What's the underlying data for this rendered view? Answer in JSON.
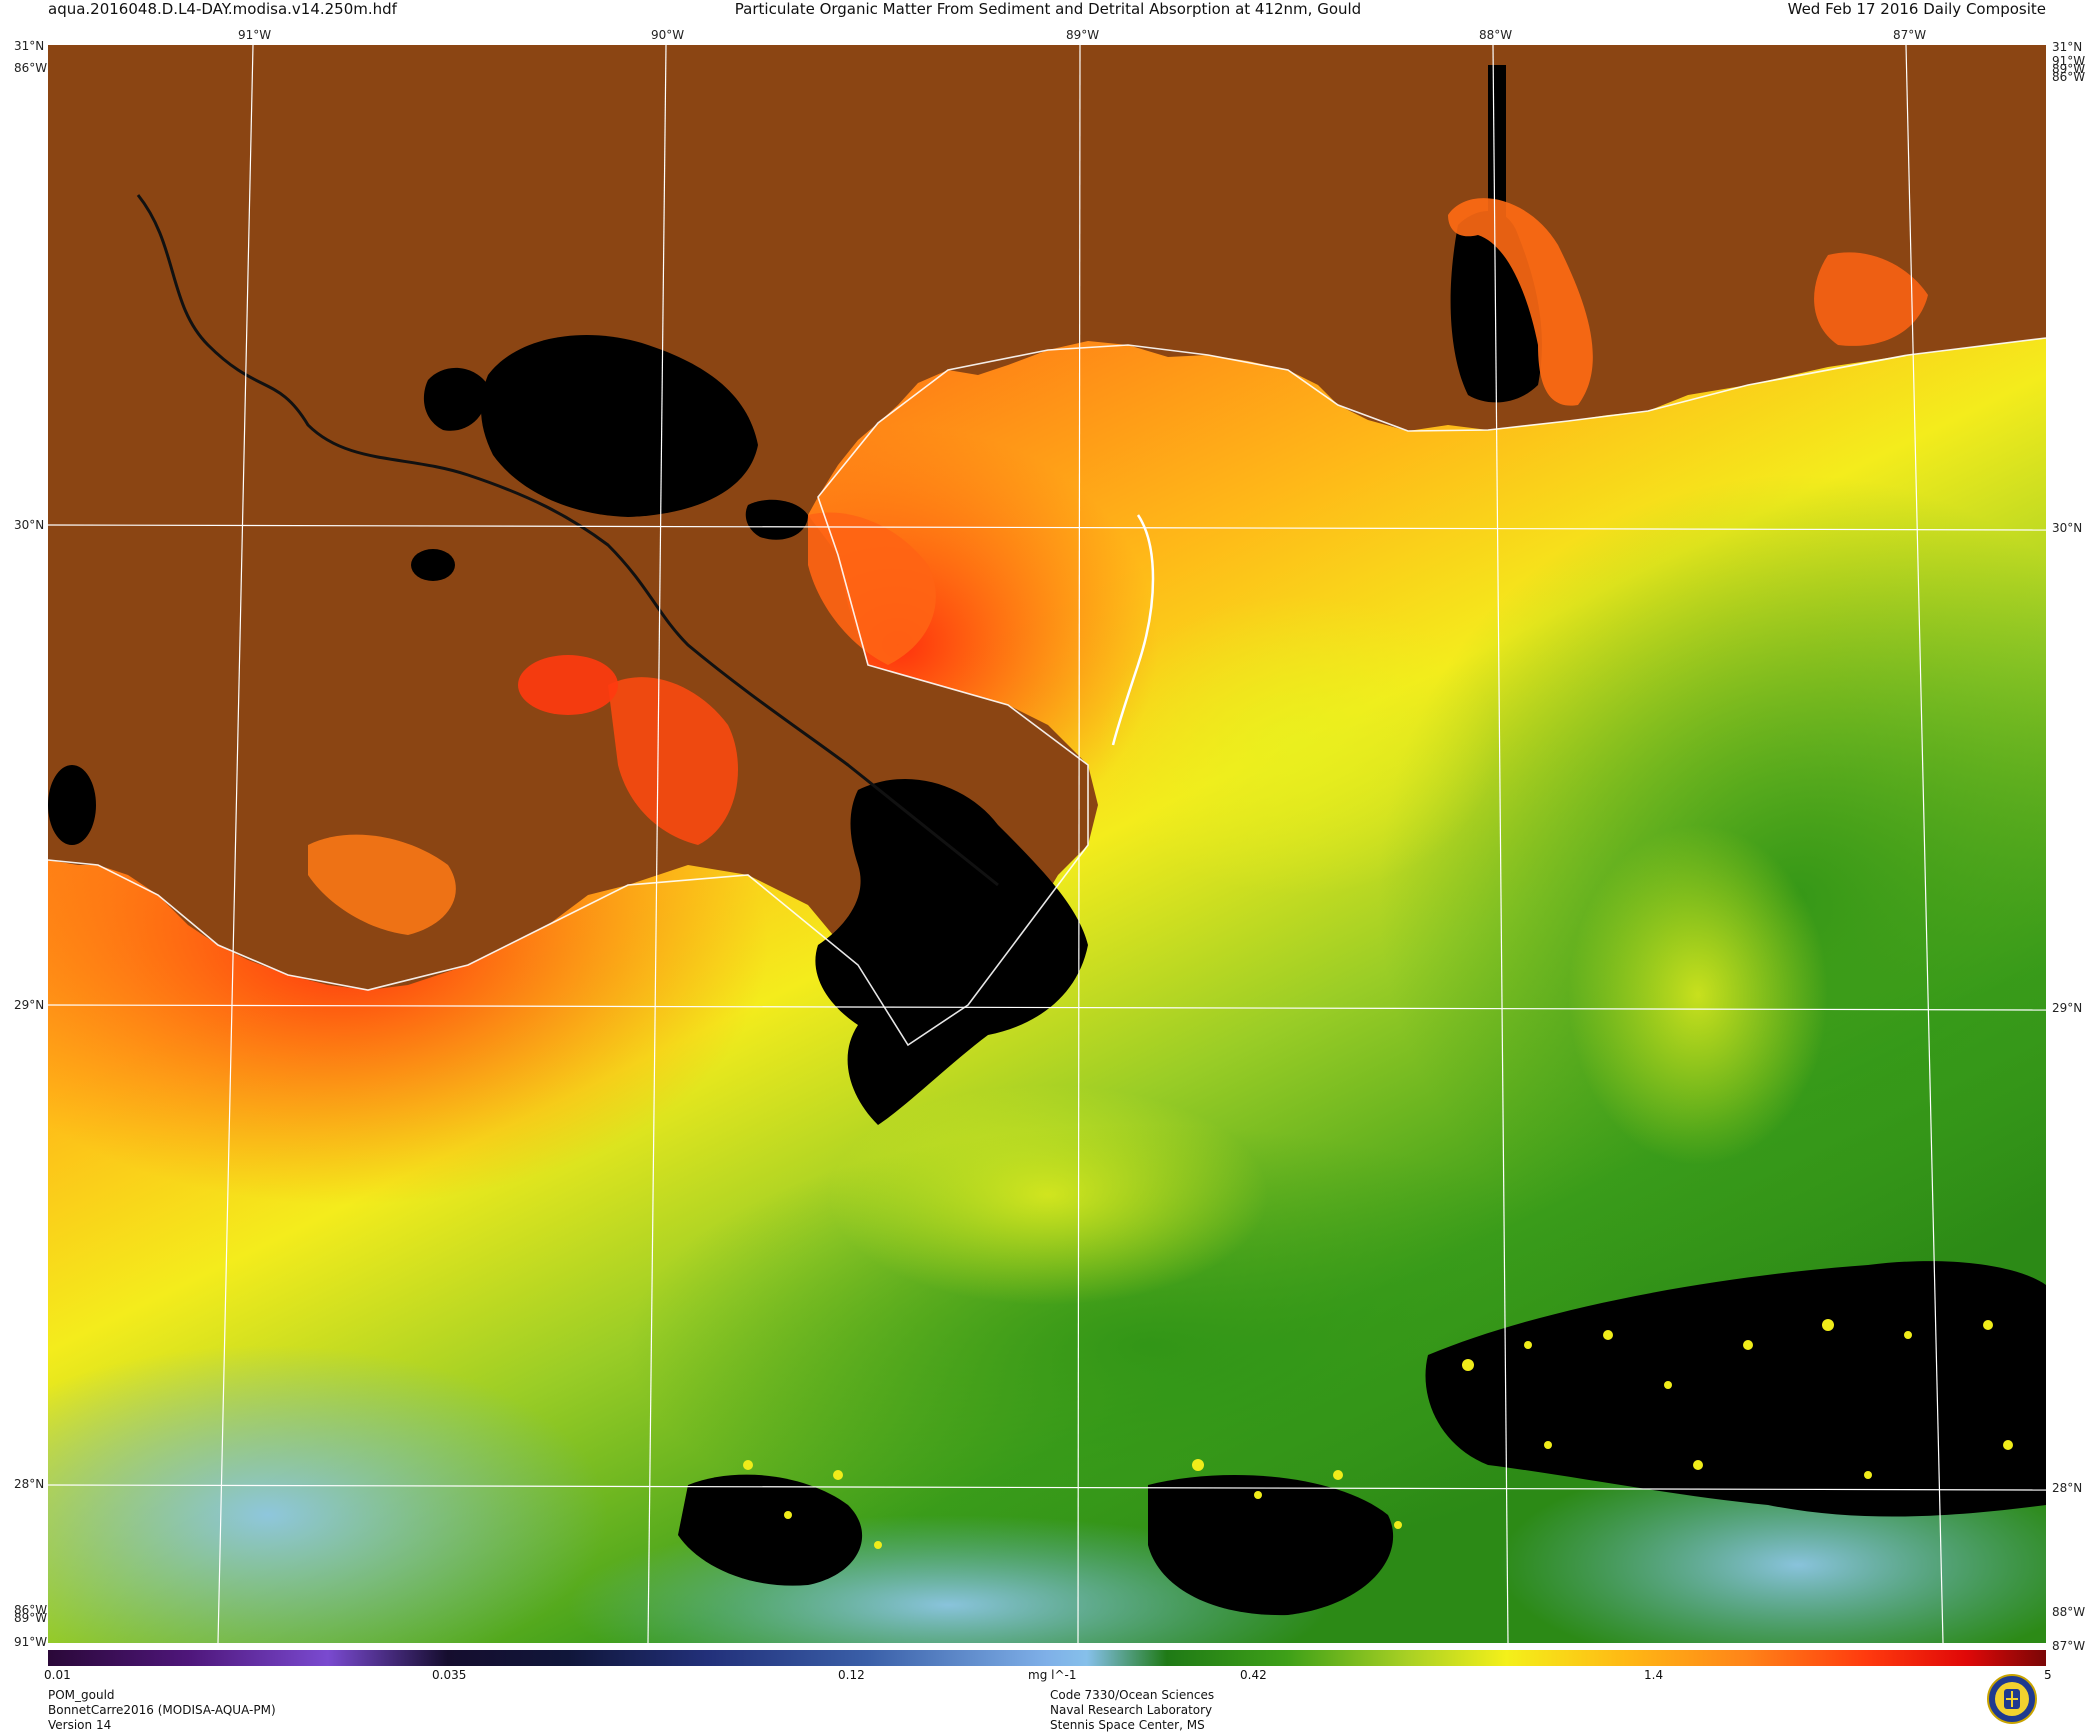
{
  "header": {
    "filename": "aqua.2016048.D.L4-DAY.modisa.v14.250m.hdf",
    "title": "Particulate Organic Matter From Sediment and Detrital Absorption at 412nm, Gould",
    "date": "Wed Feb 17 2016 Daily Composite"
  },
  "map": {
    "graticule": {
      "top_lon_labels": [
        "91°W",
        "90°W",
        "89°W",
        "88°W",
        "87°W"
      ],
      "lat_labels": [
        "30°N",
        "29°N",
        "28°N"
      ],
      "corner_labels": {
        "top_left_lat": "31°N",
        "top_left_lon": "86°W",
        "top_right_lat": "31°N",
        "top_right_lon_a": "91°W",
        "top_right_lon_b": "89°W",
        "top_right_lon_c": "86°W",
        "bottom_left_lon_a": "86°W",
        "bottom_left_lon_b": "89°W",
        "bottom_left_lon_c": "91°W",
        "bottom_right_lon_a": "88°W",
        "bottom_right_lon_b": "87°W"
      }
    },
    "colors": {
      "land": "#8b4513",
      "no_data": "#000000",
      "shoreline": "#ffffff",
      "graticule": "#ffffff",
      "high": "#ff3a10",
      "mid": "#f4ec1c",
      "low": "#3a9c1a",
      "very_low": "#8ac0e0"
    }
  },
  "colorbar": {
    "min_label": "0.01",
    "tick_labels": [
      "0.035",
      "0.12",
      "0.42",
      "1.4"
    ],
    "max_label": "5",
    "units": "mg l^-1"
  },
  "footer": {
    "product": "POM_gould",
    "dataset": "BonnetCarre2016 (MODISA-AQUA-PM)",
    "version": "Version 14",
    "org_line1": "Code 7330/Ocean Sciences",
    "org_line2": "Naval Research Laboratory",
    "org_line3": "Stennis Space Center, MS",
    "seal_icon": "nrl-seal-icon"
  }
}
